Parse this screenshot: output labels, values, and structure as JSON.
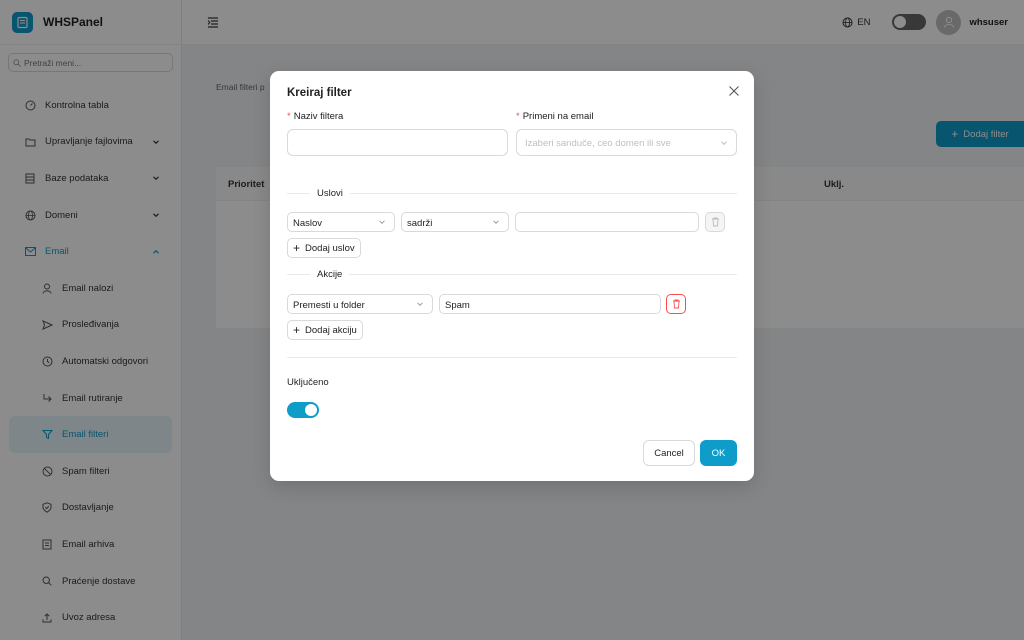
{
  "app": {
    "name": "WHSPanel"
  },
  "sidebar": {
    "search_placeholder": "Pretraži meni...",
    "items": [
      {
        "label": "Kontrolna tabla"
      },
      {
        "label": "Upravljanje fajlovima"
      },
      {
        "label": "Baze podataka"
      },
      {
        "label": "Domeni"
      },
      {
        "label": "Email"
      },
      {
        "label": "Email nalozi"
      },
      {
        "label": "Prosleđivanja"
      },
      {
        "label": "Automatski odgovori"
      },
      {
        "label": "Email rutiranje"
      },
      {
        "label": "Email filteri"
      },
      {
        "label": "Spam filteri"
      },
      {
        "label": "Dostavljanje"
      },
      {
        "label": "Email arhiva"
      },
      {
        "label": "Praćenje dostave"
      },
      {
        "label": "Uvoz adresa"
      }
    ]
  },
  "header": {
    "language": "EN",
    "username": "whsuser"
  },
  "page": {
    "breadcrumb": "Email filteri p",
    "add_button": "Dodaj filter",
    "columns": {
      "priority": "Prioritet",
      "enabled": "Uklj."
    }
  },
  "modal": {
    "title": "Kreiraj filter",
    "name_label": "Naziv filtera",
    "name_value": "",
    "apply_label": "Primeni na email",
    "apply_placeholder": "Izaberi sanduče, ceo domen ili sve",
    "conditions_title": "Uslovi",
    "condition": {
      "field": "Naslov",
      "operator": "sadrži",
      "value": ""
    },
    "add_condition": "Dodaj uslov",
    "actions_title": "Akcije",
    "action": {
      "type": "Premesti u folder",
      "value": "Spam"
    },
    "add_action": "Dodaj akciju",
    "enabled_label": "Uključeno",
    "enabled": true,
    "cancel": "Cancel",
    "ok": "OK"
  },
  "colors": {
    "accent": "#0e9cc8",
    "danger": "#ff4d4f"
  }
}
